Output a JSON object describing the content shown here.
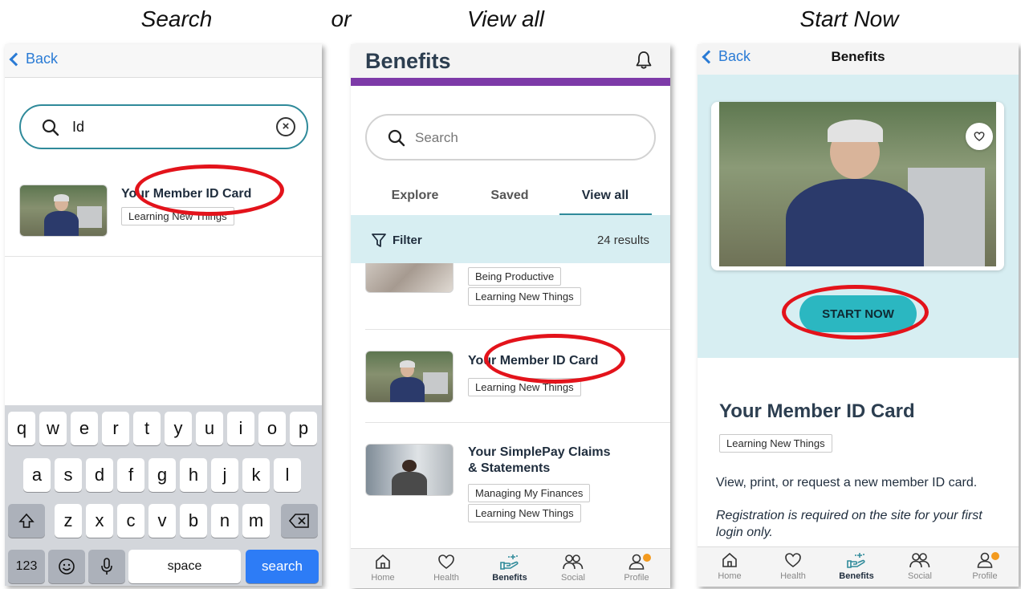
{
  "captions": {
    "search": "Search",
    "or": "or",
    "view_all": "View all",
    "start_now": "Start Now"
  },
  "screen_search": {
    "back_label": "Back",
    "search_value": "Id",
    "result": {
      "title": "Your Member ID Card",
      "tag": "Learning New Things"
    },
    "keyboard": {
      "row1": [
        "q",
        "w",
        "e",
        "r",
        "t",
        "y",
        "u",
        "i",
        "o",
        "p"
      ],
      "row2": [
        "a",
        "s",
        "d",
        "f",
        "g",
        "h",
        "j",
        "k",
        "l"
      ],
      "row3": [
        "z",
        "x",
        "c",
        "v",
        "b",
        "n",
        "m"
      ],
      "numbers_label": "123",
      "space_label": "space",
      "search_label": "search"
    }
  },
  "screen_benefits": {
    "title": "Benefits",
    "search_placeholder": "Search",
    "tabs": [
      "Explore",
      "Saved",
      "View all"
    ],
    "active_tab": "View all",
    "filter_label": "Filter",
    "results_count": "24 results",
    "items": [
      {
        "title": "",
        "tags": [
          "Being Productive",
          "Learning New Things"
        ]
      },
      {
        "title": "Your Member ID Card",
        "tags": [
          "Learning New Things"
        ]
      },
      {
        "title_line1": "Your SimplePay Claims",
        "title_line2": "& Statements",
        "tags": [
          "Managing My Finances",
          "Learning New Things"
        ]
      }
    ]
  },
  "screen_detail": {
    "back_label": "Back",
    "title": "Benefits",
    "start_button": "START NOW",
    "heading": "Your Member ID Card",
    "tag": "Learning New Things",
    "description": "View, print, or request a new member ID card.",
    "note": "Registration is required on the site for your first login only."
  },
  "tabbar": {
    "home": "Home",
    "health": "Health",
    "benefits": "Benefits",
    "social": "Social",
    "profile": "Profile"
  },
  "colors": {
    "accent_teal": "#2f8a9a",
    "brand_purple": "#7d3aa8",
    "highlight_red": "#e3131b",
    "start_button": "#2bb7c1",
    "panel_teal": "#d7eef2",
    "notification": "#f39a1e",
    "ios_blue": "#2d7cf6"
  }
}
